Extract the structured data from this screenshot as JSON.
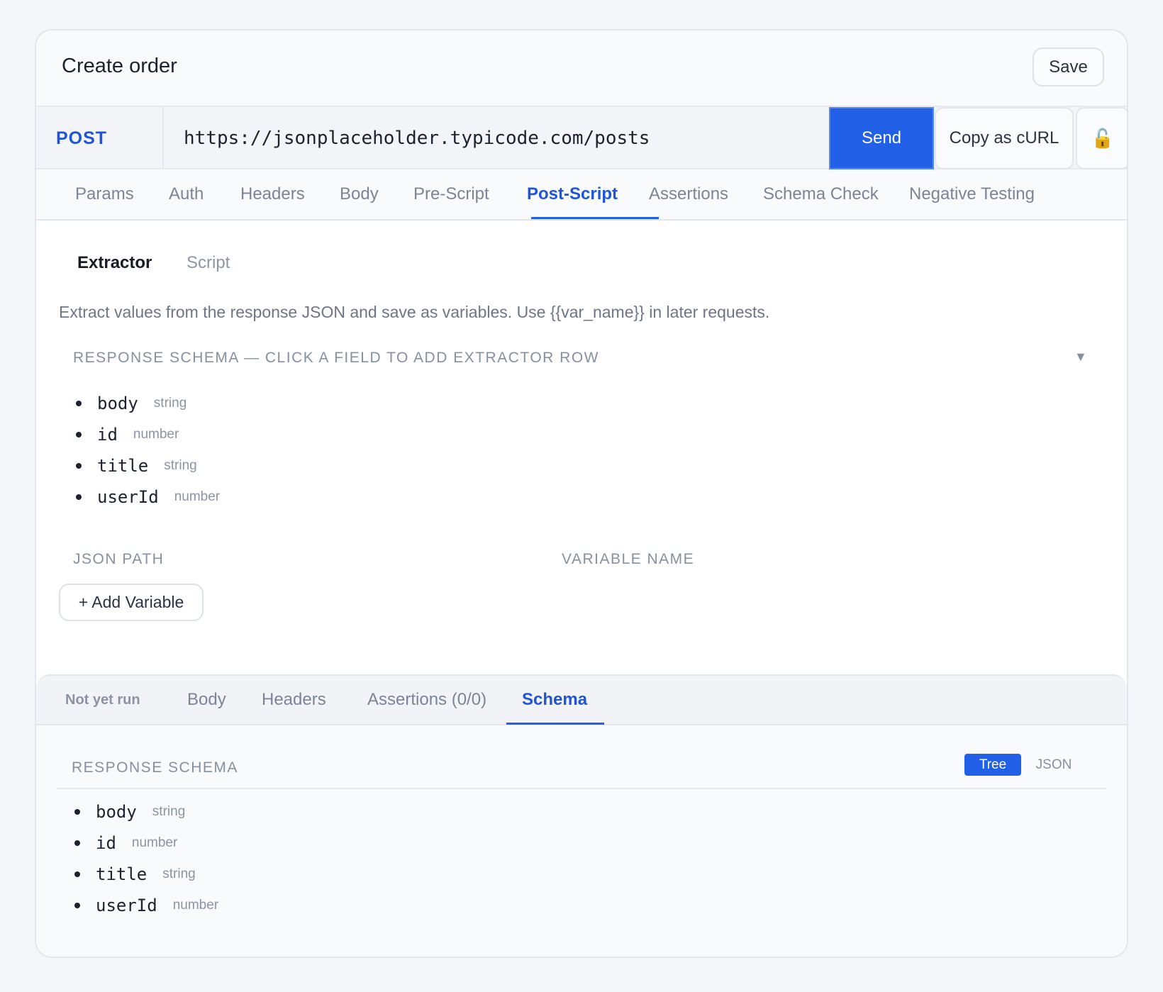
{
  "header": {
    "title": "Create order",
    "save_label": "Save"
  },
  "request": {
    "method": "POST",
    "url": "https://jsonplaceholder.typicode.com/posts",
    "send_label": "Send",
    "copy_curl_label": "Copy as cURL",
    "lock_icon": "🔓"
  },
  "tabs": [
    "Params",
    "Auth",
    "Headers",
    "Body",
    "Pre-Script",
    "Post-Script",
    "Assertions",
    "Schema Check",
    "Negative Testing"
  ],
  "active_tab": "Post-Script",
  "post_script": {
    "subtabs": [
      "Extractor",
      "Script"
    ],
    "active_subtab": "Extractor",
    "description": "Extract values from the response JSON and save as variables. Use {{var_name}} in later requests.",
    "schema_title": "RESPONSE SCHEMA — CLICK A FIELD TO ADD EXTRACTOR ROW",
    "caret": "▼",
    "fields": [
      {
        "name": "body",
        "type": "string"
      },
      {
        "name": "id",
        "type": "number"
      },
      {
        "name": "title",
        "type": "string"
      },
      {
        "name": "userId",
        "type": "number"
      }
    ],
    "col_json_path": "JSON PATH",
    "col_variable_name": "VARIABLE NAME",
    "add_variable_label": "+ Add Variable"
  },
  "response": {
    "status": "Not yet run",
    "tabs": [
      "Body",
      "Headers",
      "Assertions (0/0)",
      "Schema"
    ],
    "active_tab": "Schema",
    "schema_title": "RESPONSE SCHEMA",
    "view_tree": "Tree",
    "view_json": "JSON",
    "fields": [
      {
        "name": "body",
        "type": "string"
      },
      {
        "name": "id",
        "type": "number"
      },
      {
        "name": "title",
        "type": "string"
      },
      {
        "name": "userId",
        "type": "number"
      }
    ]
  },
  "colors": {
    "accent": "#2360e8",
    "method": "#1f55d6"
  }
}
